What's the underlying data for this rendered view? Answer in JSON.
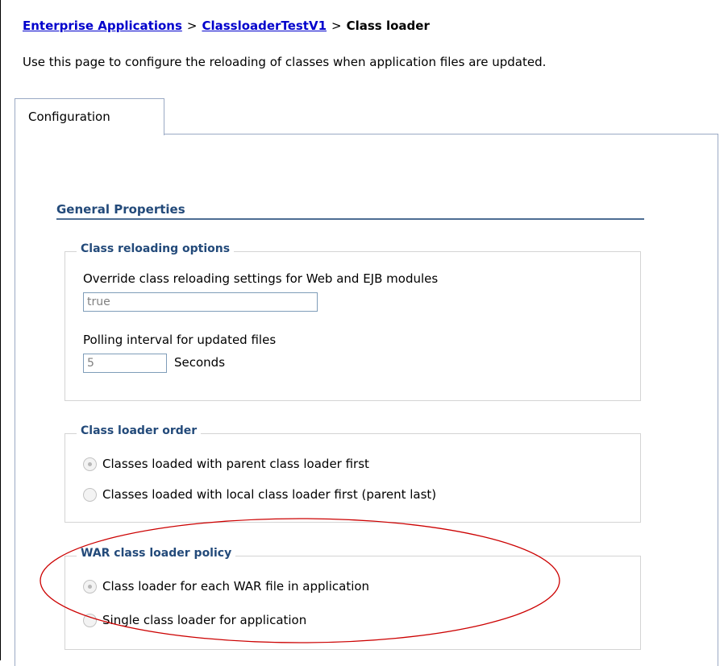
{
  "breadcrumb": {
    "link1": "Enterprise Applications",
    "sep1": ">",
    "link2": "ClassloaderTestV1",
    "sep2": ">",
    "current": "Class loader"
  },
  "intro": "Use this page to configure the reloading of classes when application files are updated.",
  "tab": {
    "label": "Configuration"
  },
  "general_properties": {
    "title": "General Properties"
  },
  "class_reloading": {
    "legend": "Class reloading options",
    "override_label": "Override class reloading settings for Web and EJB modules",
    "override_value": "true",
    "polling_label": "Polling interval for updated files",
    "polling_value": "5",
    "polling_unit": "Seconds"
  },
  "class_loader_order": {
    "legend": "Class loader order",
    "option1": "Classes loaded with parent class loader first",
    "option2": "Classes loaded with local class loader first (parent last)",
    "selected": "option1"
  },
  "war_policy": {
    "legend": "WAR class loader policy",
    "option1": "Class loader for each WAR file in application",
    "option2": "Single class loader for application",
    "selected": "option1"
  },
  "colors": {
    "link": "#0000cc",
    "heading": "#234a7a",
    "annotation": "#cc0000"
  }
}
